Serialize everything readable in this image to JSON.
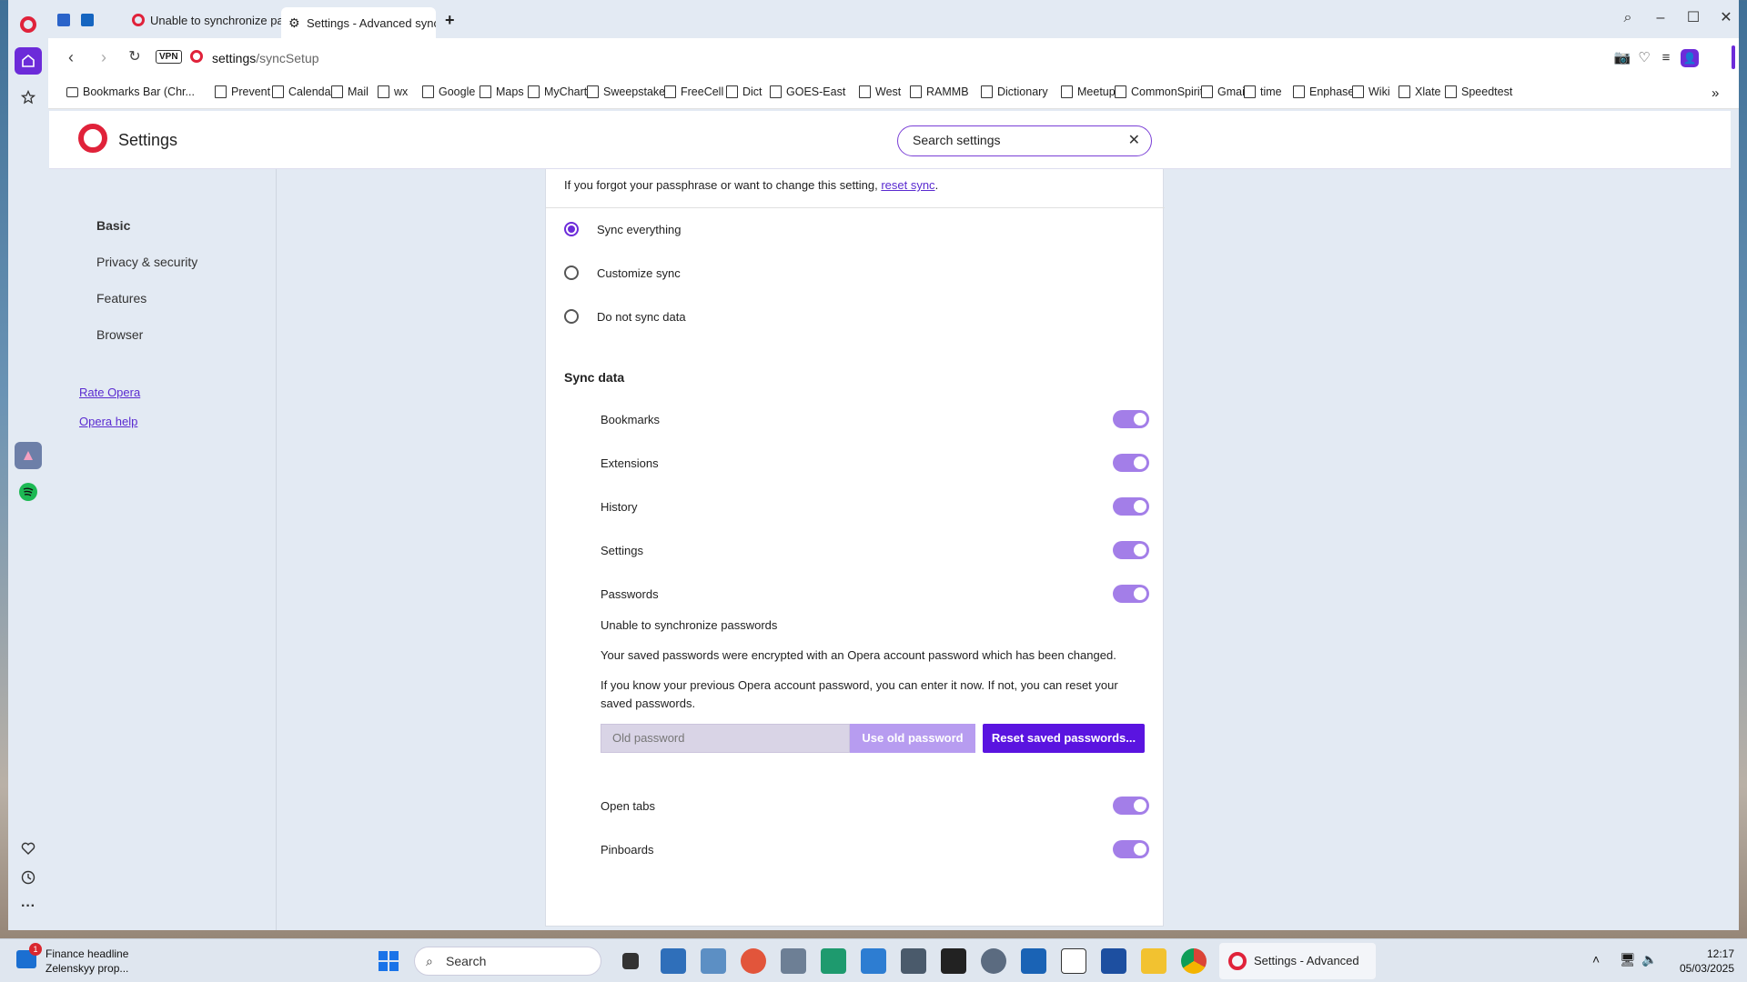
{
  "tabs": [
    {
      "label": "Unable to synchronize pa",
      "active": false
    },
    {
      "label": "Settings - Advanced sync",
      "active": true
    }
  ],
  "toolbar": {
    "vpn_label": "VPN",
    "url_host": "settings",
    "url_path": "/syncSetup"
  },
  "bookmarks": [
    "Bookmarks Bar (Chr...",
    "Prevent",
    "Calendar",
    "Mail",
    "wx",
    "Google",
    "Maps",
    "MyChart",
    "Sweepstakes",
    "FreeCell",
    "Dict",
    "GOES-East",
    "West",
    "RAMMB",
    "Dictionary",
    "Meetup",
    "CommonSpirit",
    "Gmail",
    "time",
    "Enphase",
    "Wiki",
    "Xlate",
    "Speedtest"
  ],
  "header": {
    "title": "Settings",
    "search_value": "Search settings"
  },
  "nav": {
    "items": [
      "Basic",
      "Privacy & security",
      "Features",
      "Browser"
    ],
    "rate_link": "Rate Opera",
    "help_link": "Opera help"
  },
  "sync": {
    "passphrase_text": "If you forgot your passphrase or want to change this setting, ",
    "reset_link": "reset sync",
    "period": ".",
    "options": [
      "Sync everything",
      "Customize sync",
      "Do not sync data"
    ],
    "selected_option": "Sync everything",
    "section_title": "Sync data",
    "items": [
      "Bookmarks",
      "Extensions",
      "History",
      "Settings",
      "Passwords"
    ],
    "items_after": [
      "Open tabs",
      "Pinboards"
    ],
    "pw_error_title": "Unable to synchronize passwords",
    "pw_error_body": "Your saved passwords were encrypted with an Opera account password which has been changed.",
    "pw_hint_1": "If you know your previous Opera account password, you can enter it now. If not, you can reset your",
    "pw_hint_2": "saved passwords.",
    "old_password_placeholder": "Old password",
    "use_old_label": "Use old password",
    "reset_label": "Reset saved passwords..."
  },
  "taskbar": {
    "news_badge": "1",
    "news_title": "Finance headline",
    "news_sub": "Zelenskyy prop...",
    "search_label": "Search",
    "active_app": "Settings - Advanced syr",
    "time": "12:17",
    "date": "05/03/2025"
  }
}
